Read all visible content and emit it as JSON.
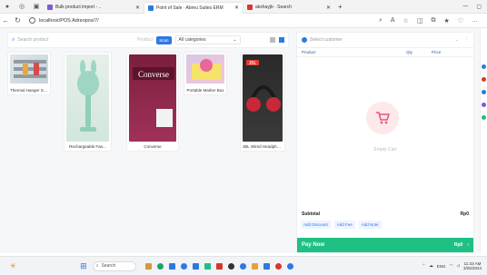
{
  "browser": {
    "tabs": [
      {
        "label": "Bulk product import - ..",
        "active": false,
        "color": "#7d5bd1"
      },
      {
        "label": "Point of Sale · Abreu Suites ERM",
        "active": true,
        "color": "#2d78e4"
      },
      {
        "label": "akshayjb · Search",
        "active": false,
        "color": "#d8372b"
      }
    ],
    "new_tab": "+",
    "url": "localhost/POS Adreopos/7/"
  },
  "toolbar": {
    "search_placeholder": "Search product",
    "product_label": "Product",
    "scan_label": "Scan",
    "category_value": "All categories"
  },
  "products": [
    {
      "name": "Thermal Hanger Shelf...",
      "colors": [
        "#dfe6e8",
        "#c6d2da"
      ]
    },
    {
      "name": "Rechargeable Fan...",
      "colors": [
        "#d8e8e4",
        "#9ed6c3"
      ]
    },
    {
      "name": "Converse",
      "colors": [
        "#7a1f3d",
        "#a1315a"
      ]
    },
    {
      "name": "Portable Marker Box",
      "colors": [
        "#d8c8e4",
        "#f2c5d6"
      ]
    },
    {
      "name": "JBL Wired Headphones",
      "colors": [
        "#2a2a2a",
        "#3a3a3a"
      ]
    }
  ],
  "cart": {
    "customer_placeholder": "Select customer",
    "columns": [
      "Product",
      "Qty",
      "Price"
    ],
    "empty_text": "Empty Cart",
    "subtotal_label": "Subtotal",
    "subtotal_value": "Rp0",
    "actions": [
      "Add Discount",
      "Add Fee",
      "Add Note"
    ],
    "pay_label": "Pay Now",
    "pay_value": "Rp0"
  },
  "taskbar": {
    "search_placeholder": "Search",
    "lang": "ENG",
    "time": "11:33 AM",
    "date": "3/25/2024"
  }
}
